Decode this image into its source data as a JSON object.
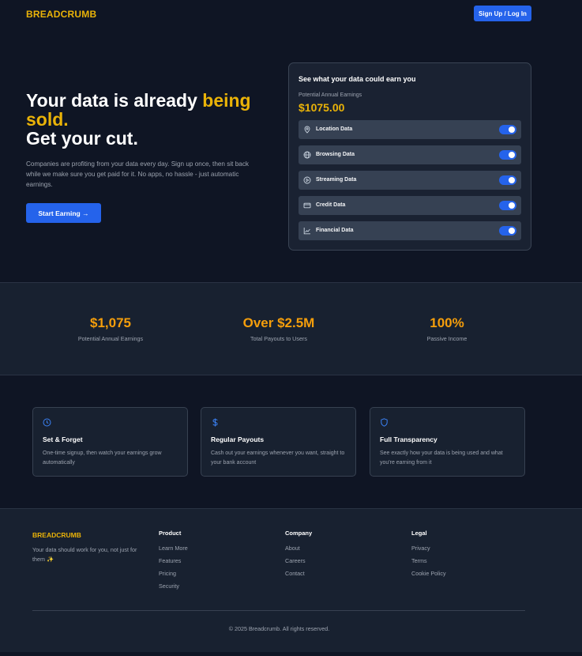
{
  "nav": {
    "logo": "BREADCRUMB",
    "signup_label": "Sign Up / Log In"
  },
  "hero": {
    "headline_part1": "Your data is already ",
    "headline_accent": "being sold.",
    "headline_line2": "Get your cut.",
    "description": "Companies are profiting from your data every day. Sign up once, then sit back while we make sure you get paid for it. No apps, no hassle - just automatic earnings.",
    "cta_label": "Start Earning →"
  },
  "calculator": {
    "title": "See what your data could earn you",
    "subtitle": "Potential Annual Earnings",
    "amount": "$1075.00",
    "items": [
      {
        "label": "Location Data",
        "icon": "location-pin-icon",
        "enabled": true
      },
      {
        "label": "Browsing Data",
        "icon": "globe-icon",
        "enabled": true
      },
      {
        "label": "Streaming Data",
        "icon": "play-circle-icon",
        "enabled": true
      },
      {
        "label": "Credit Data",
        "icon": "credit-card-icon",
        "enabled": true
      },
      {
        "label": "Financial Data",
        "icon": "chart-line-icon",
        "enabled": true
      }
    ]
  },
  "stats": [
    {
      "value": "$1,075",
      "caption": "Potential Annual Earnings"
    },
    {
      "value": "Over $2.5M",
      "caption": "Total Payouts to Users"
    },
    {
      "value": "100%",
      "caption": "Passive Income"
    }
  ],
  "features": [
    {
      "icon": "clock-icon",
      "title": "Set & Forget",
      "description": "One-time signup, then watch your earnings grow automatically"
    },
    {
      "icon": "dollar-icon",
      "title": "Regular Payouts",
      "description": "Cash out your earnings whenever you want, straight to your bank account"
    },
    {
      "icon": "shield-icon",
      "title": "Full Transparency",
      "description": "See exactly how your data is being used and what you're earning from it"
    }
  ],
  "footer": {
    "logo": "BREADCRUMB",
    "tagline": "Your data should work for you, not just for them ✨",
    "columns": [
      {
        "heading": "Product",
        "links": [
          "Learn More",
          "Features",
          "Pricing",
          "Security"
        ]
      },
      {
        "heading": "Company",
        "links": [
          "About",
          "Careers",
          "Contact"
        ]
      },
      {
        "heading": "Legal",
        "links": [
          "Privacy",
          "Terms",
          "Cookie Policy"
        ]
      }
    ],
    "copyright": "© 2025 Breadcrumb. All rights reserved."
  },
  "colors": {
    "accent": "#eab308",
    "primary": "#2563eb",
    "background": "#0f1524",
    "stat_value": "#f59e0b"
  }
}
